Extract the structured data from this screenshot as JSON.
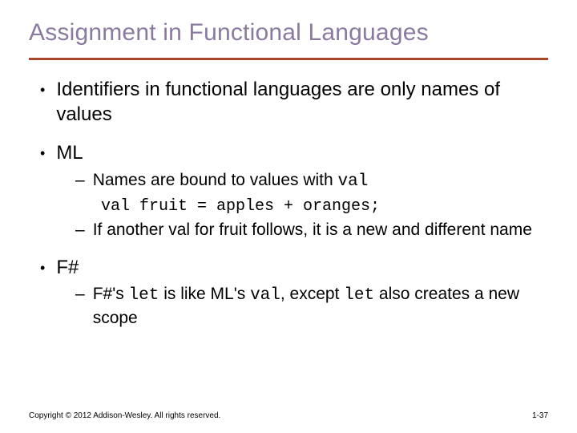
{
  "title": "Assignment in Functional Languages",
  "bullets": {
    "b1": "Identifiers in functional languages are only names of values",
    "b2": "ML",
    "b2_1_pre": "Names are bound to values with ",
    "b2_1_code": "val",
    "b2_code_line": "val fruit = apples + oranges;",
    "b2_2": "If another val for fruit follows, it is a new and different name",
    "b3": "F#",
    "b3_1_a": "F#'s ",
    "b3_1_b": "let",
    "b3_1_c": " is like ML's ",
    "b3_1_d": "val",
    "b3_1_e": ", except ",
    "b3_1_f": "let",
    "b3_1_g": " also creates a new scope"
  },
  "footer": {
    "copyright": "Copyright © 2012 Addison-Wesley. All rights reserved.",
    "page": "1-37"
  }
}
